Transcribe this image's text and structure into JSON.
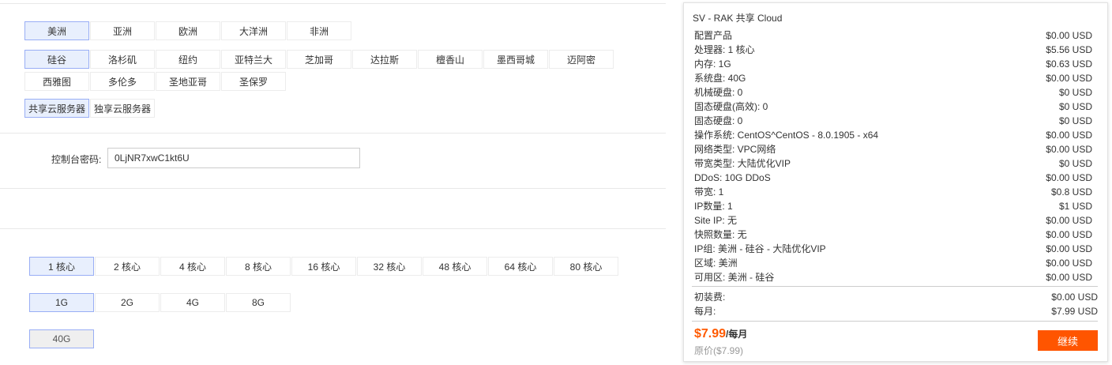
{
  "region": {
    "options": [
      "美洲",
      "亚洲",
      "欧洲",
      "大洋洲",
      "非洲"
    ],
    "selected": 0
  },
  "city": {
    "options": [
      "硅谷",
      "洛杉矶",
      "纽约",
      "亚特兰大",
      "芝加哥",
      "达拉斯",
      "檀香山",
      "墨西哥城",
      "迈阿密",
      "西雅图",
      "多伦多",
      "圣地亚哥",
      "圣保罗"
    ],
    "selected": 0
  },
  "server_type": {
    "options": [
      "共享云服务器",
      "独享云服务器"
    ],
    "selected": 0
  },
  "password": {
    "label": "控制台密码:",
    "value": "0LjNR7xwC1kt6U"
  },
  "cpu": {
    "options": [
      "1 核心",
      "2 核心",
      "4 核心",
      "8 核心",
      "16 核心",
      "32 核心",
      "48 核心",
      "64 核心",
      "80 核心"
    ],
    "selected": 0
  },
  "memory": {
    "options": [
      "1G",
      "2G",
      "4G",
      "8G"
    ],
    "selected": 0
  },
  "disk": {
    "options": [
      "40G"
    ],
    "selected": 0
  },
  "summary": {
    "title": "SV - RAK 共享 Cloud",
    "items": [
      {
        "label": "配置产品",
        "price": "$0.00 USD"
      },
      {
        "label": "处理器: 1 核心",
        "price": "$5.56 USD"
      },
      {
        "label": "内存: 1G",
        "price": "$0.63 USD"
      },
      {
        "label": "系统盘: 40G",
        "price": "$0.00 USD"
      },
      {
        "label": "机械硬盘: 0",
        "price": "$0 USD"
      },
      {
        "label": "固态硬盘(高效): 0",
        "price": "$0 USD"
      },
      {
        "label": "固态硬盘: 0",
        "price": "$0 USD"
      },
      {
        "label": "操作系统: CentOS^CentOS - 8.0.1905 - x64",
        "price": "$0.00 USD"
      },
      {
        "label": "网络类型: VPC网络",
        "price": "$0.00 USD"
      },
      {
        "label": "带宽类型: 大陆优化VIP",
        "price": "$0 USD"
      },
      {
        "label": "DDoS: 10G DDoS",
        "price": "$0.00 USD"
      },
      {
        "label": "带宽: 1",
        "price": "$0.8 USD"
      },
      {
        "label": "IP数量: 1",
        "price": "$1 USD"
      },
      {
        "label": "Site IP: 无",
        "price": "$0.00 USD"
      },
      {
        "label": "快照数量: 无",
        "price": "$0.00 USD"
      },
      {
        "label": "IP组: 美洲 - 硅谷 - 大陆优化VIP",
        "price": "$0.00 USD"
      },
      {
        "label": "区域: 美洲",
        "price": "$0.00 USD"
      },
      {
        "label": "可用区: 美洲 - 硅谷",
        "price": "$0.00 USD"
      }
    ],
    "setup_label": "初装费:",
    "setup_price": "$0.00 USD",
    "monthly_label": "每月:",
    "monthly_price": "$7.99 USD",
    "total": "$7.99",
    "per": "/每月",
    "original": "原价($7.99)",
    "continue": "继续"
  },
  "colors": {
    "accent": "#ff5500",
    "selected_bg": "#e8effd",
    "selected_border": "#99aef5"
  }
}
